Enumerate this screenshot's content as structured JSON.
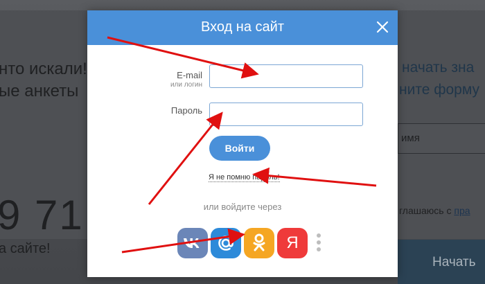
{
  "background": {
    "left_line1": "нто искали!",
    "left_line2": "ые анкеты",
    "left_number": "9 71",
    "left_line3": "а сайте!",
    "right_line1": "начать зна",
    "right_line2": "ните форму",
    "right_input": "имя",
    "right_agree": "глашаюсь с ",
    "right_agree_link": "пра",
    "right_button": "Начать"
  },
  "modal": {
    "title": "Вход на сайт",
    "email_label": "E-mail",
    "email_sublabel": "или логин",
    "email_value": "",
    "password_label": "Пароль",
    "password_value": "",
    "login_button": "Войти",
    "forgot_link": "Я не помню пароль!",
    "or_text": "или войдите через",
    "social": [
      {
        "name": "vk",
        "icon": "vk-icon",
        "color": "#6b86b8"
      },
      {
        "name": "mail",
        "icon": "mail-ru-icon",
        "color": "#2d8ad9"
      },
      {
        "name": "odnoklassniki",
        "icon": "odnoklassniki-icon",
        "color": "#f5a623"
      },
      {
        "name": "yandex",
        "icon": "yandex-icon",
        "glyph": "Я",
        "color": "#ef3a3a"
      }
    ]
  },
  "colors": {
    "accent": "#4a90d9",
    "annotation": "#e01010"
  }
}
